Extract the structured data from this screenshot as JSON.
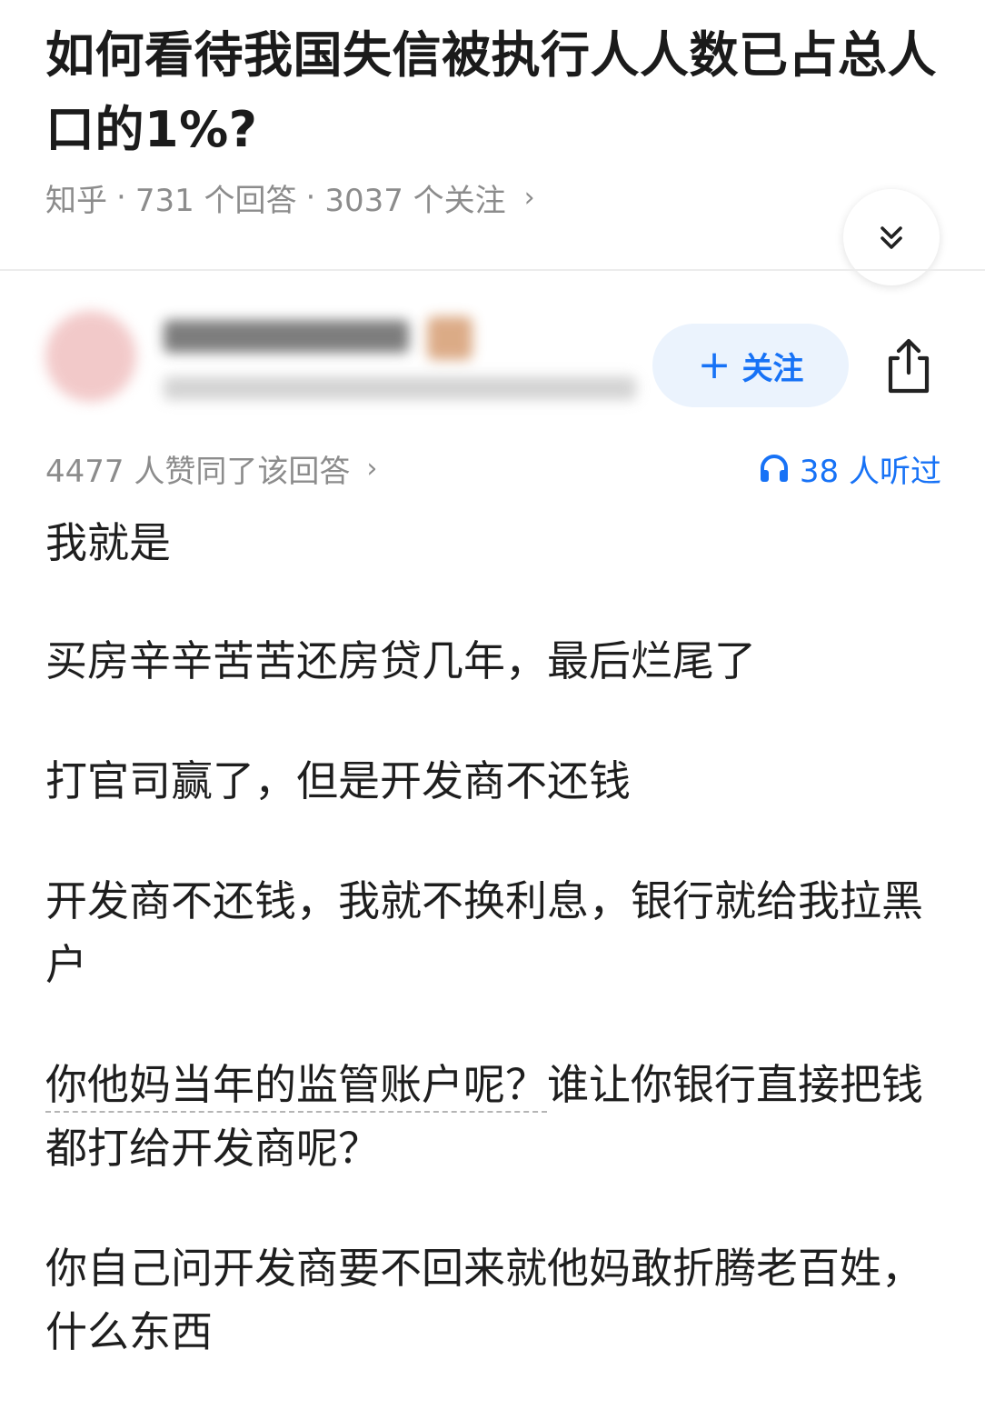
{
  "question": {
    "title": "如何看待我国失信被执行人人数已占总人口的1%?",
    "meta": {
      "source": "知乎",
      "separator": "·",
      "answers": "731 个回答",
      "followers": "3037 个关注",
      "chevron": "›"
    },
    "collapse_icon": "double-chevron-down-icon"
  },
  "answer": {
    "author_blurred": true,
    "follow_button": {
      "plus": "+",
      "label": "关注"
    },
    "share_icon": "share-icon",
    "stats": {
      "upvotes_text": "4477 人赞同了该回答",
      "chevron": "›"
    },
    "listen": {
      "icon": "headphones-icon",
      "text": "38 人听过"
    },
    "paragraphs": [
      "我就是",
      "买房辛辛苦苦还房贷几年，最后烂尾了",
      "打官司赢了，但是开发商不还钱",
      "开发商不还钱，我就不换利息，银行就给我拉黑户",
      "谁让你银行直接把钱都打给开发商呢？",
      "你自己问开发商要不回来就他妈敢折腾老百姓，什么东西"
    ],
    "highlighted_phrase": "你他妈当年的监管账户呢？"
  },
  "colors": {
    "accent": "#1772f6",
    "follow_bg": "#ebf3fd",
    "meta_gray": "#8c8c8c",
    "title": "#1b1b1b"
  }
}
